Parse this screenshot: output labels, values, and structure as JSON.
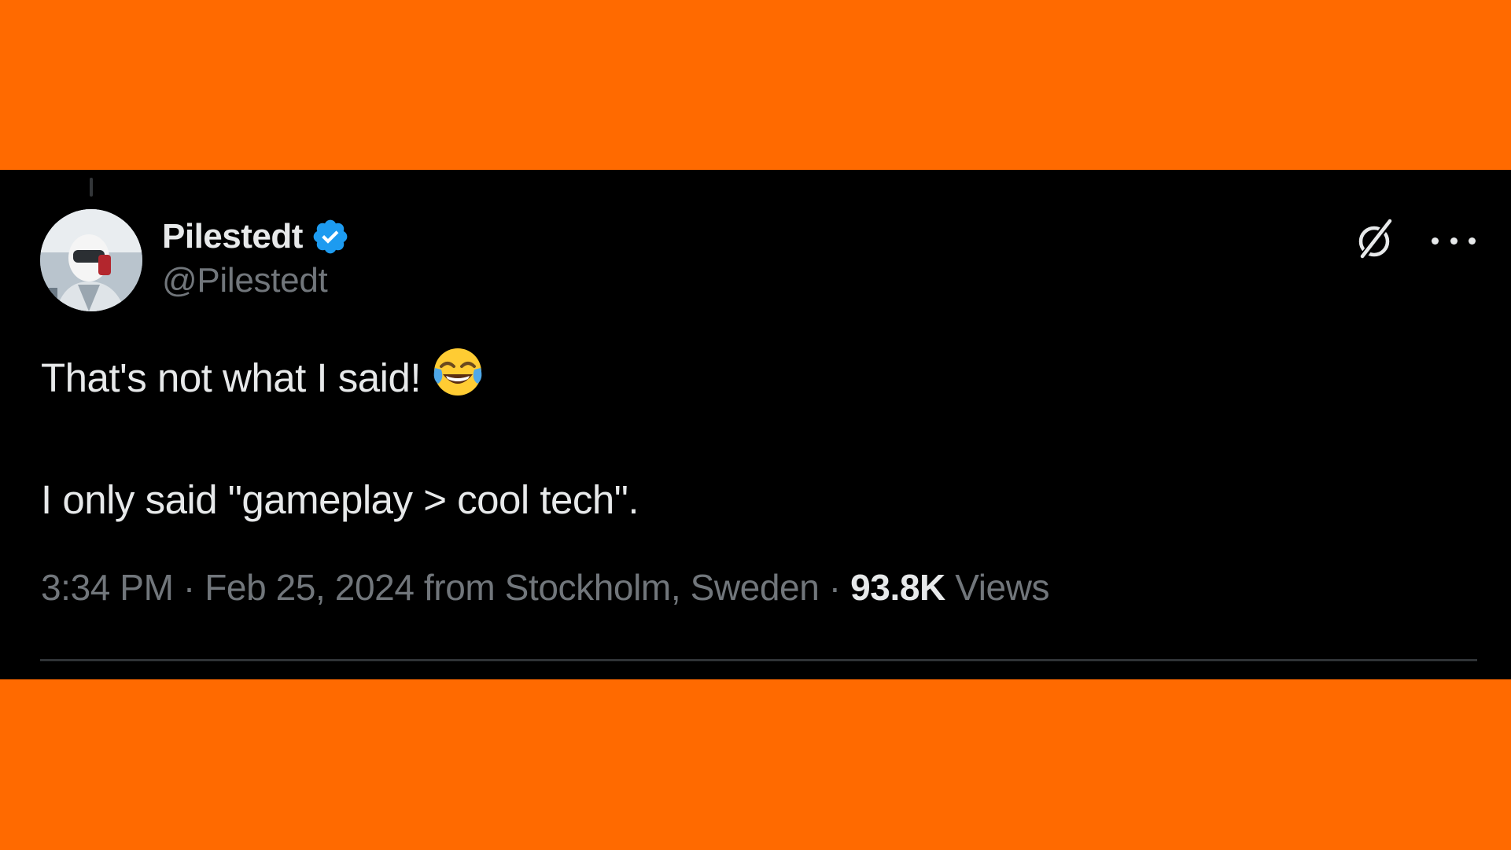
{
  "tweet": {
    "author": {
      "display_name": "Pilestedt",
      "handle": "@Pilestedt",
      "verified": true,
      "verified_color": "#1d9bf0"
    },
    "text_line_1": "That's not what I said!",
    "emoji": "face-with-tears-of-joy",
    "text_line_2": "I only said \"gameplay > cool tech\".",
    "time": "3:34 PM",
    "separator_1": " · ",
    "date": "Feb 25, 2024",
    "location": " from Stockholm, Sweden",
    "separator_2": " · ",
    "views_count": "93.8K",
    "views_label": " Views"
  },
  "icons": {
    "grok": "grok-icon",
    "more": "more-icon",
    "verified": "verified-badge-icon"
  },
  "colors": {
    "background_frame": "#ff6a00",
    "card_background": "#000000",
    "primary_text": "#e7e9ea",
    "secondary_text": "#71767b",
    "divider": "#2f3336"
  }
}
